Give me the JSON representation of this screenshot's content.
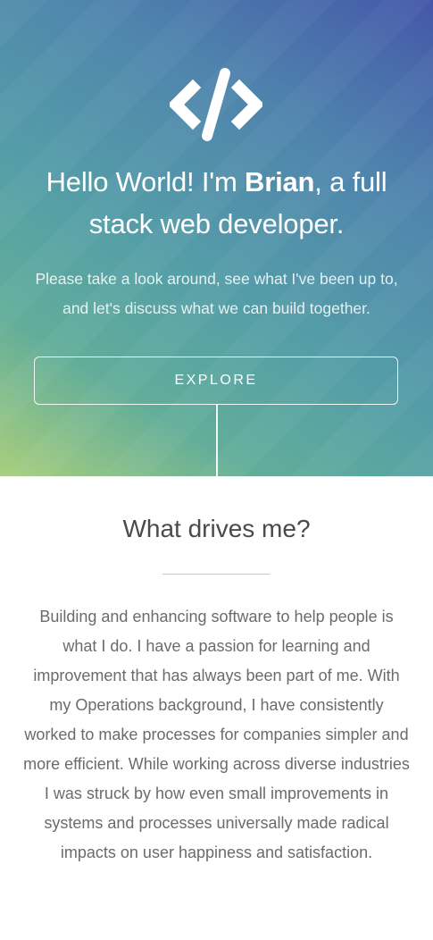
{
  "hero": {
    "logo_icon": "code-brackets-icon",
    "heading_prefix": "Hello World! I'm ",
    "heading_name": "Brian",
    "heading_suffix": ", a full stack web developer.",
    "subtitle": "Please take a look around, see what I've been up to, and let's discuss what we can build together.",
    "button_label": "EXPLORE"
  },
  "about": {
    "title": "What drives me?",
    "body": "Building and enhancing software to help people is what I do. I have a passion for learning and improvement that has always been part of me. With my Operations background, I have consistently worked to make processes for companies simpler and more efficient. While working across diverse industries I was struck by how even small improvements in systems and processes universally made radical impacts on user happiness and satisfaction."
  },
  "colors": {
    "hero_gradient_start": "#4458a9",
    "hero_gradient_mid": "#559fa7",
    "hero_gradient_end": "#a9cf7d",
    "text_primary": "#ffffff",
    "about_title": "#4a4a4a",
    "about_text": "#6b6b6b"
  }
}
